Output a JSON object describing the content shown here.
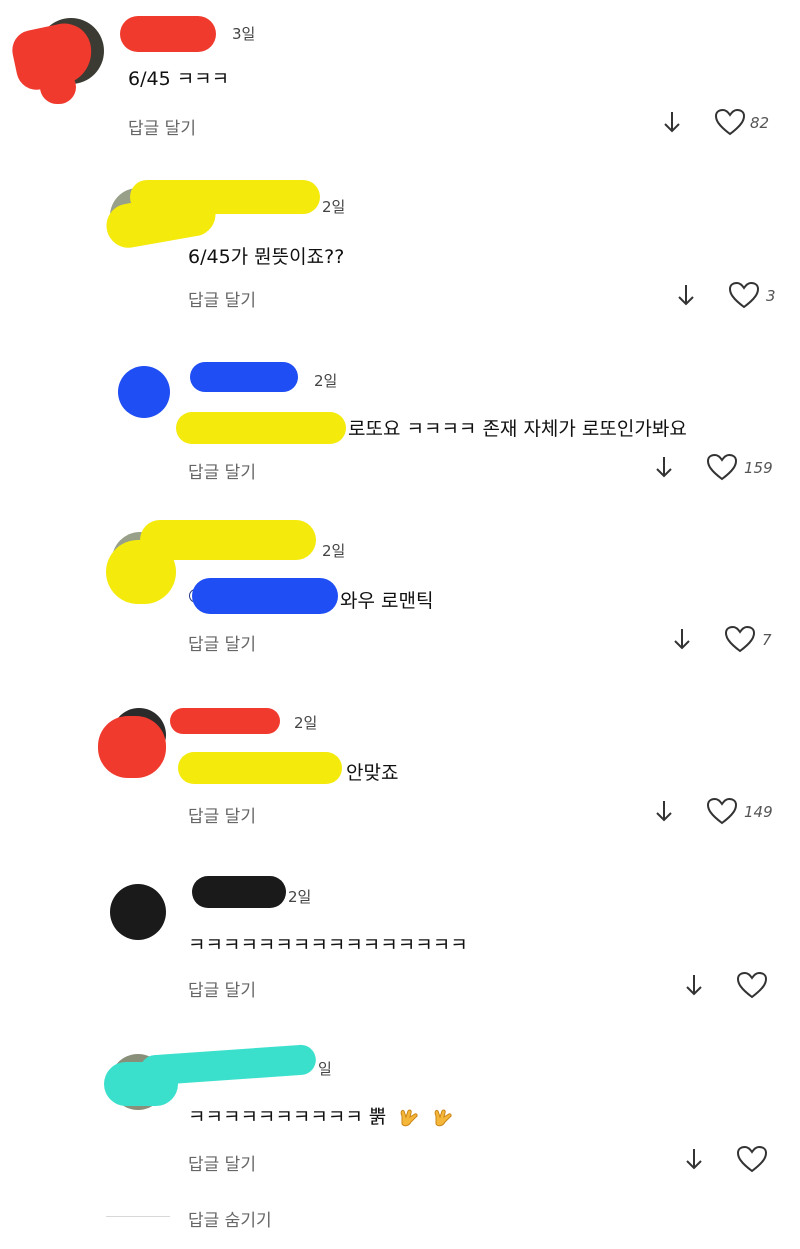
{
  "comments": [
    {
      "time": "3일",
      "text": "6/45 ㅋㅋㅋ",
      "reply": "답글 달기",
      "likes": "82"
    },
    {
      "time": "2일",
      "text": "6/45가 뭔뜻이죠??",
      "reply": "답글 달기",
      "likes": "3"
    },
    {
      "time": "2일",
      "mention": "@",
      "text": "로또요 ㅋㅋㅋㅋ 존재 자체가 로또인가봐요",
      "reply": "답글 달기",
      "likes": "159"
    },
    {
      "time": "2일",
      "mention": "@",
      "text": "와우 로맨틱",
      "reply": "답글 달기",
      "likes": "7"
    },
    {
      "time": "2일",
      "text": "안맞죠",
      "reply": "답글 달기",
      "likes": "149"
    },
    {
      "time": "2일",
      "text": "ㅋㅋㅋㅋㅋㅋㅋㅋㅋㅋㅋㅋㅋㅋㅋㅋ",
      "reply": "답글 달기",
      "likes": ""
    },
    {
      "time": "일",
      "text": "ㅋㅋㅋㅋㅋㅋㅋㅋㅋㅋ 뿕",
      "reply": "답글 달기",
      "likes": ""
    }
  ],
  "hide_replies": "답글 숨기기",
  "icons": {
    "down": "arrow-down-icon",
    "like": "heart-icon",
    "emoji": "call-me-hand-emoji"
  },
  "colors": {
    "red": "#f03a2e",
    "yellow": "#f4ea0c",
    "blue": "#1f4ef5",
    "black": "#1a1a1a",
    "cyan": "#3be0cc"
  }
}
